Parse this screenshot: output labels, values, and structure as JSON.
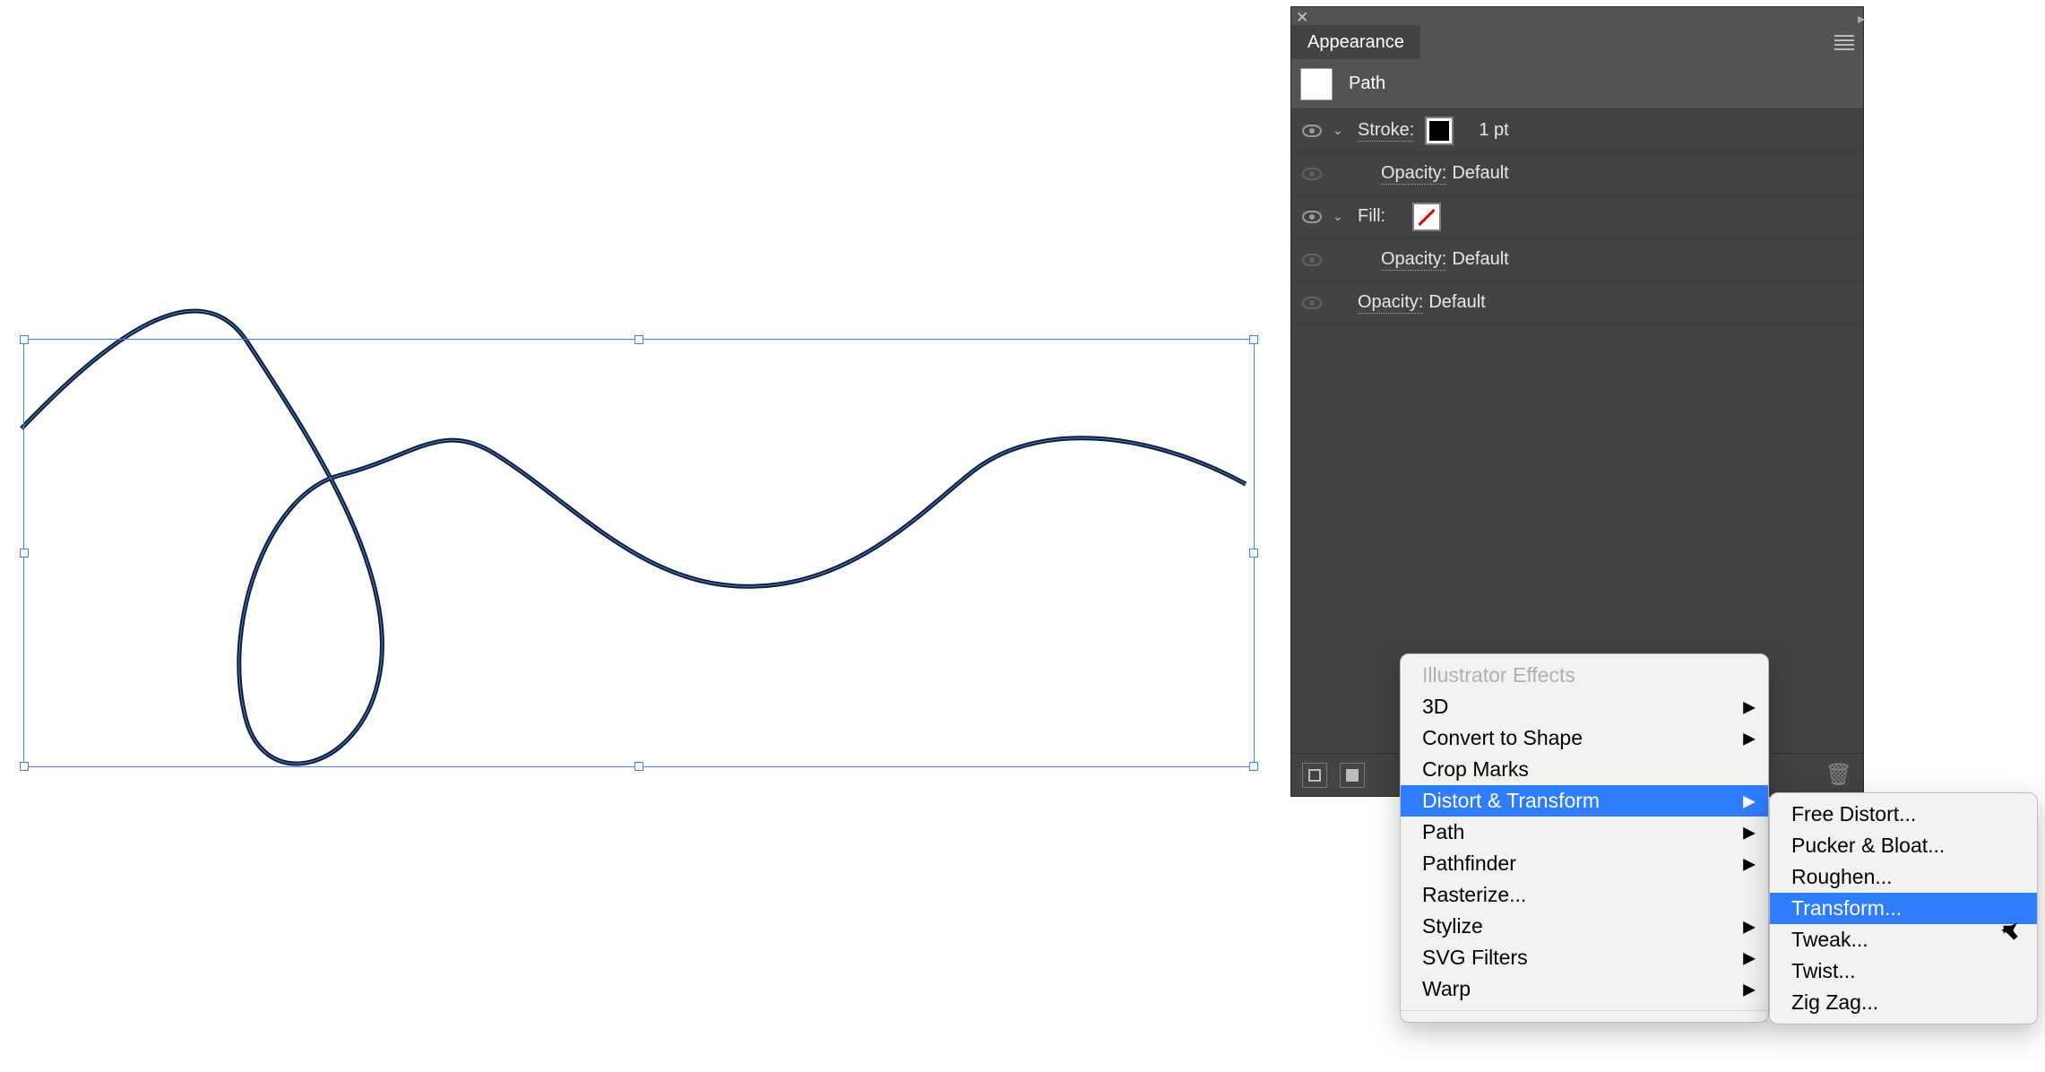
{
  "panel": {
    "title": "Appearance",
    "sel_type": "Path",
    "stroke_label": "Stroke:",
    "stroke_value": "1 pt",
    "opacity_label": "Opacity:",
    "opacity_default": "Default",
    "fill_label": "Fill:"
  },
  "menu1": {
    "header": "Illustrator Effects",
    "items": [
      {
        "label": "3D",
        "sub": true
      },
      {
        "label": "Convert to Shape",
        "sub": true
      },
      {
        "label": "Crop Marks",
        "sub": false
      },
      {
        "label": "Distort & Transform",
        "sub": true,
        "hl": true
      },
      {
        "label": "Path",
        "sub": true
      },
      {
        "label": "Pathfinder",
        "sub": true
      },
      {
        "label": "Rasterize...",
        "sub": false
      },
      {
        "label": "Stylize",
        "sub": true
      },
      {
        "label": "SVG Filters",
        "sub": true
      },
      {
        "label": "Warp",
        "sub": true
      }
    ]
  },
  "menu2": {
    "items": [
      {
        "label": "Free Distort..."
      },
      {
        "label": "Pucker & Bloat..."
      },
      {
        "label": "Roughen..."
      },
      {
        "label": "Transform...",
        "hl": true
      },
      {
        "label": "Tweak..."
      },
      {
        "label": "Twist..."
      },
      {
        "label": "Zig Zag..."
      }
    ]
  }
}
